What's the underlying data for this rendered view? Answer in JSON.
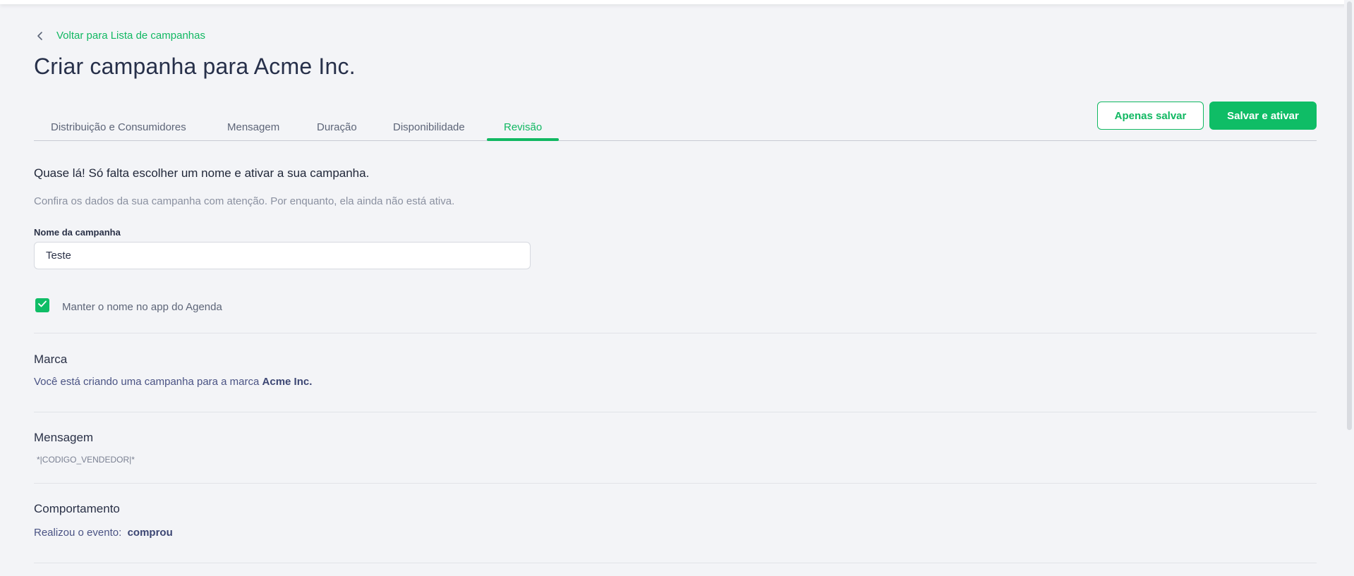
{
  "nav": {
    "back_label": "Voltar para Lista de campanhas"
  },
  "page": {
    "title": "Criar campanha para Acme Inc."
  },
  "tabs": [
    {
      "label": "Distribuição e Consumidores",
      "active": false
    },
    {
      "label": "Mensagem",
      "active": false
    },
    {
      "label": "Duração",
      "active": false
    },
    {
      "label": "Disponibilidade",
      "active": false
    },
    {
      "label": "Revisão",
      "active": true
    }
  ],
  "actions": {
    "save_only_label": "Apenas salvar",
    "save_activate_label": "Salvar e ativar"
  },
  "review": {
    "heading": "Quase lá! Só falta escolher um nome e ativar a sua campanha.",
    "subtext": "Confira os dados da sua campanha com atenção. Por enquanto, ela ainda não está ativa.",
    "name_label": "Nome da campanha",
    "name_value": "Teste",
    "keep_name_checked": true,
    "keep_name_label": "Manter o nome no app do Agenda"
  },
  "sections": {
    "brand": {
      "title": "Marca",
      "text_prefix": "Você está criando uma campanha para a marca ",
      "brand_name": "Acme Inc."
    },
    "message": {
      "title": "Mensagem",
      "content": "*|CODIGO_VENDEDOR|*"
    },
    "behavior": {
      "title": "Comportamento",
      "text_prefix": "Realizou o evento:",
      "event": "comprou"
    }
  },
  "colors": {
    "accent": "#0fbd66",
    "background": "#f3f4f7",
    "title": "#27304a"
  },
  "icons": {
    "back": "chevron-left-icon",
    "check": "check-icon"
  }
}
